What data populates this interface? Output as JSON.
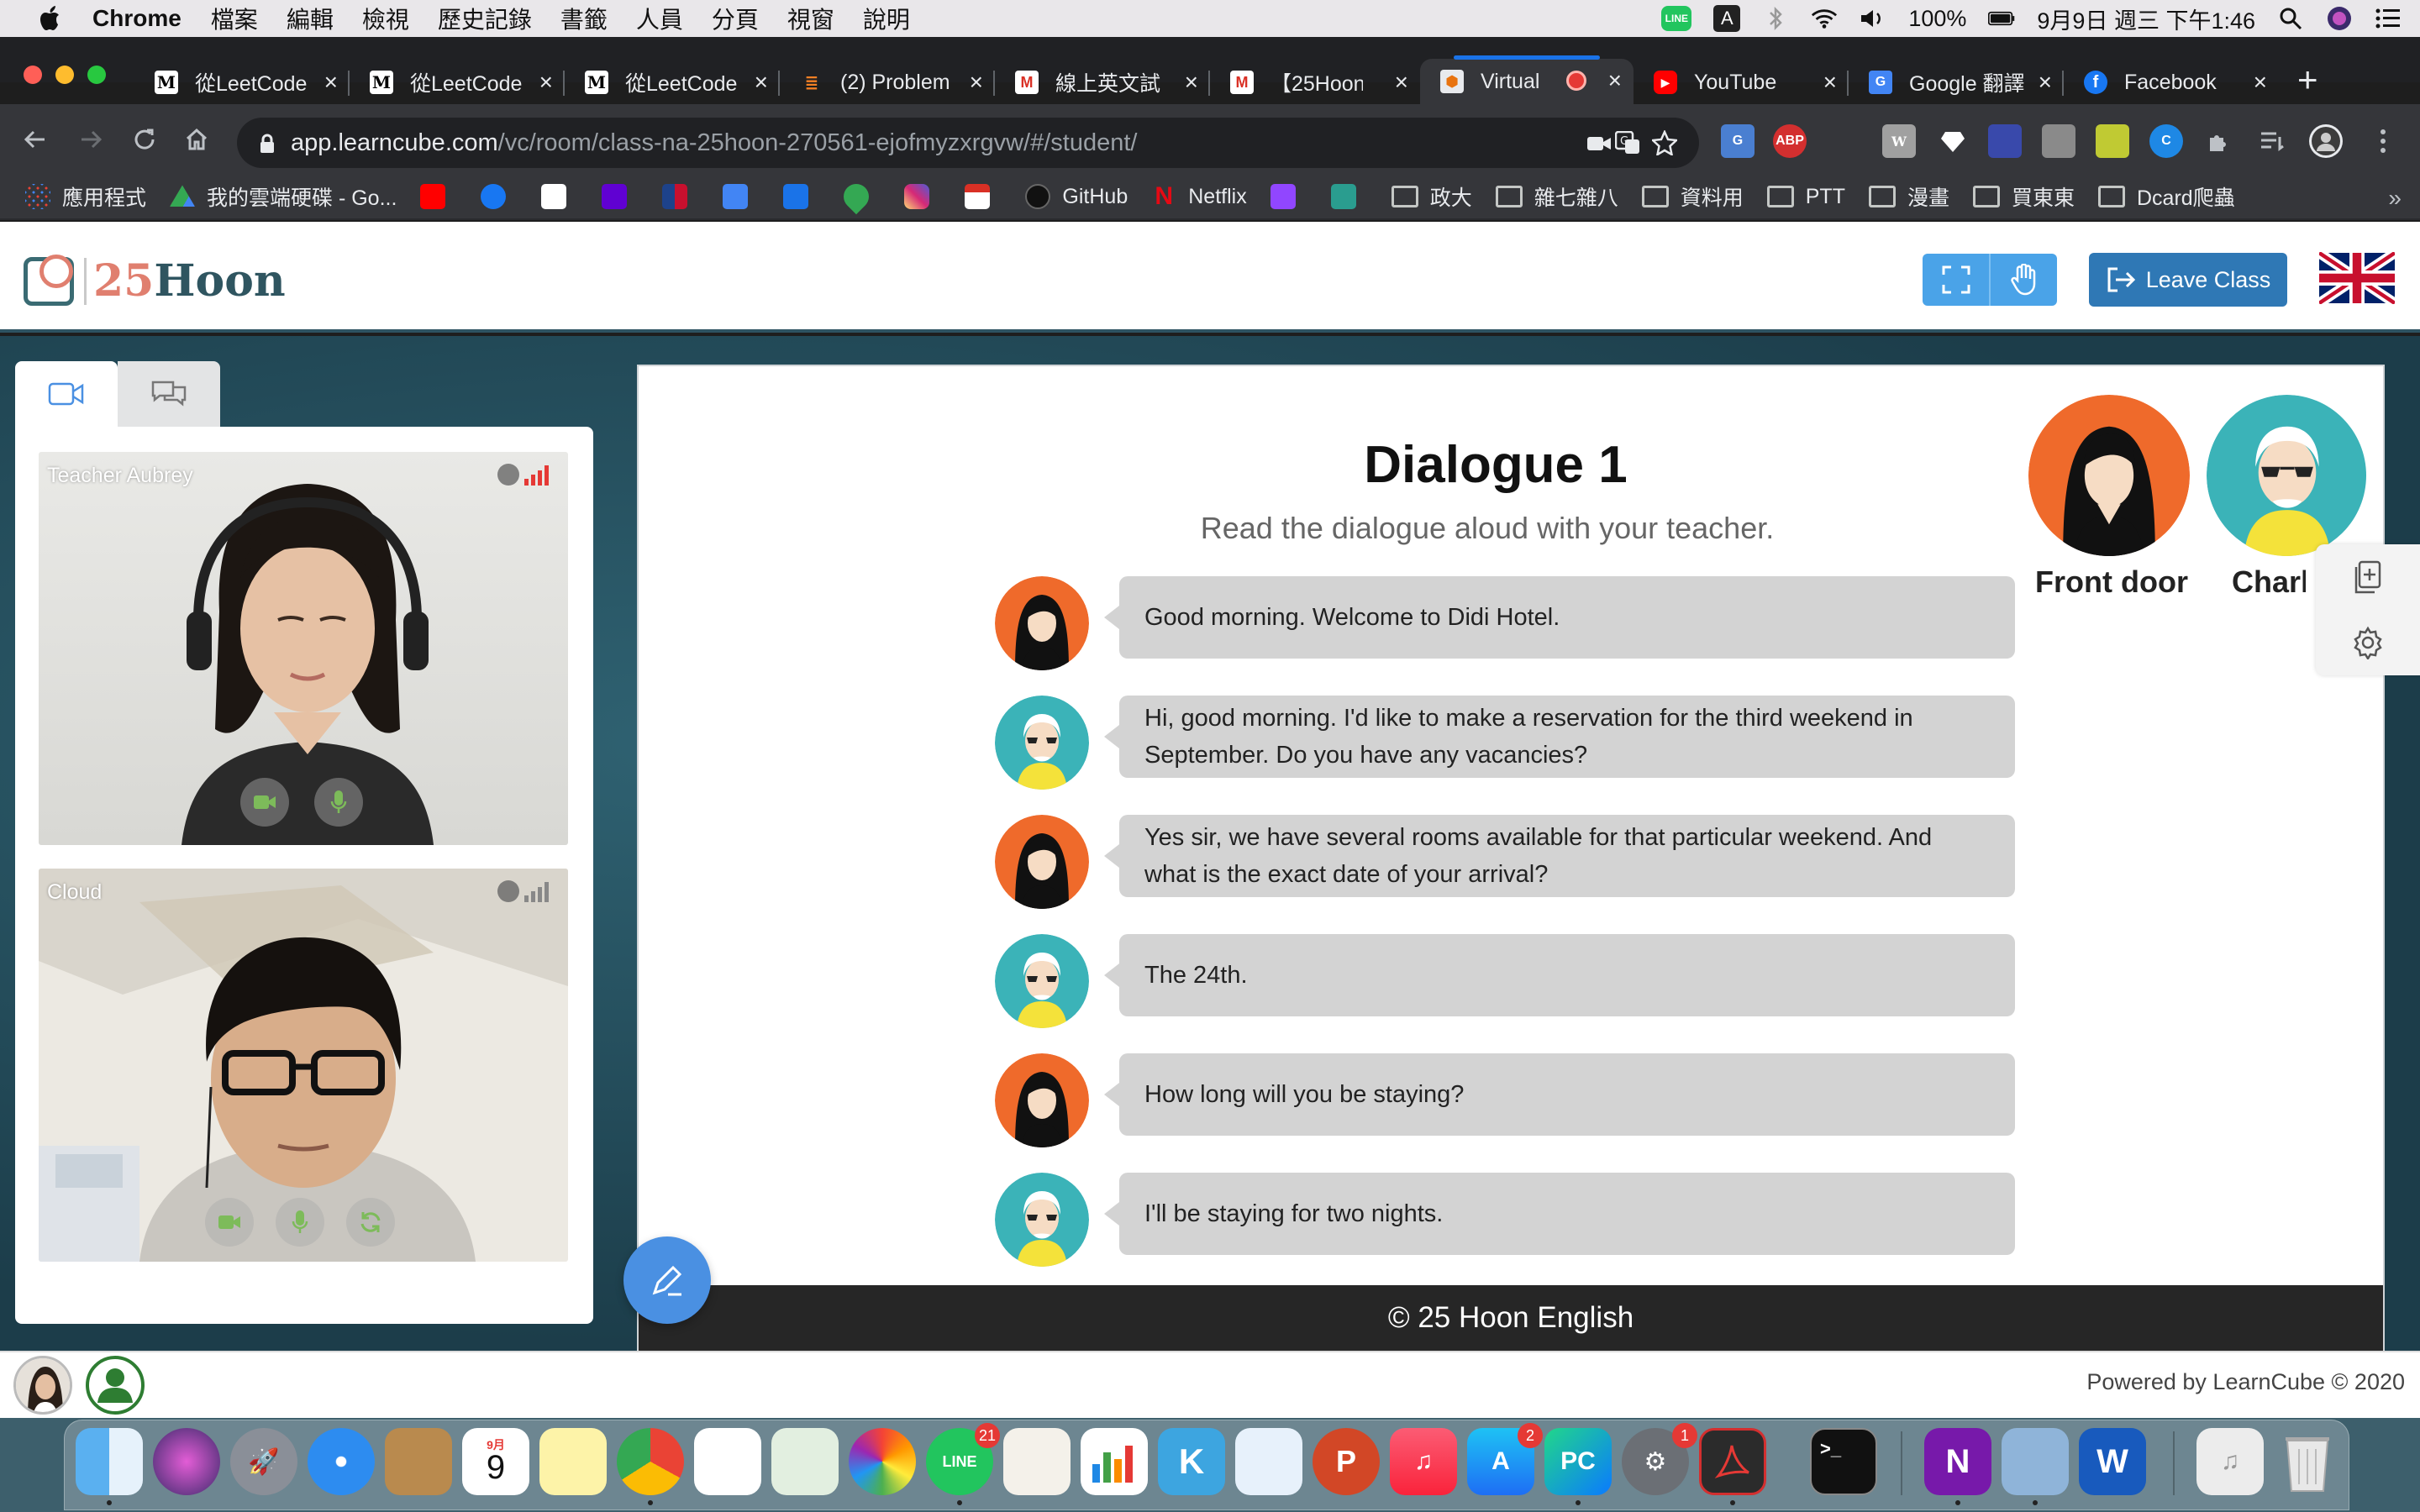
{
  "menubar": {
    "app_name": "Chrome",
    "items": [
      "檔案",
      "編輯",
      "檢視",
      "歷史記錄",
      "書籤",
      "人員",
      "分頁",
      "視窗",
      "說明"
    ],
    "line_label": "LINE",
    "input_label": "A",
    "battery": "100%",
    "datetime": "9月9日 週三 下午1:46"
  },
  "tabs": [
    {
      "title": "從LeetCode",
      "icon": "medium-icon"
    },
    {
      "title": "從LeetCode",
      "icon": "medium-icon"
    },
    {
      "title": "從LeetCode",
      "icon": "medium-icon"
    },
    {
      "title": "(2) Problem",
      "icon": "stackoverflow-icon"
    },
    {
      "title": "線上英文試",
      "icon": "gmail-icon"
    },
    {
      "title": "【25Hoon",
      "icon": "gmail-icon"
    },
    {
      "title": "Virtual",
      "icon": "learncube-icon",
      "active": true
    },
    {
      "title": "YouTube",
      "icon": "youtube-icon"
    },
    {
      "title": "Google 翻譯",
      "icon": "google-translate-icon"
    },
    {
      "title": "Facebook",
      "icon": "facebook-icon"
    }
  ],
  "omnibox": {
    "host": "app.learncube.com",
    "path": "/vc/room/class-na-25hoon-270561-ejofmyzxrgvw/#/student/"
  },
  "extensions": {
    "abp": "ABP",
    "wiki": "W",
    "c": "C"
  },
  "bookmarks": [
    {
      "label": "應用程式",
      "type": "apps"
    },
    {
      "label": "我的雲端硬碟 - Go...",
      "type": "drive"
    },
    {
      "label": "",
      "type": "youtube"
    },
    {
      "label": "",
      "type": "facebook"
    },
    {
      "label": "",
      "type": "wikipedia"
    },
    {
      "label": "",
      "type": "yahoo"
    },
    {
      "label": "",
      "type": "nba"
    },
    {
      "label": "",
      "type": "translate"
    },
    {
      "label": "",
      "type": "docs"
    },
    {
      "label": "",
      "type": "maps"
    },
    {
      "label": "",
      "type": "instagram"
    },
    {
      "label": "",
      "type": "gmail"
    },
    {
      "label": "GitHub",
      "type": "github"
    },
    {
      "label": "Netflix",
      "type": "netflix"
    },
    {
      "label": "",
      "type": "twitch"
    },
    {
      "label": "",
      "type": "other"
    },
    {
      "label": "政大",
      "type": "folder"
    },
    {
      "label": "雜七雜八",
      "type": "folder"
    },
    {
      "label": "資料用",
      "type": "folder"
    },
    {
      "label": "PTT",
      "type": "folder"
    },
    {
      "label": "漫畫",
      "type": "folder"
    },
    {
      "label": "買東東",
      "type": "folder"
    },
    {
      "label": "Dcard爬蟲",
      "type": "folder"
    }
  ],
  "header": {
    "logo_num": "25",
    "logo_word": "Hoon",
    "leave_label": "Leave Class"
  },
  "videos": {
    "teacher_name": "Teacher Aubrey",
    "student_name": "Cloud"
  },
  "slide": {
    "title": "Dialogue 1",
    "subtitle": "Read the dialogue aloud with your teacher.",
    "characters": [
      {
        "name": "Front door",
        "color": "#ef6a2b"
      },
      {
        "name": "Charles",
        "color": "#3bb3b8"
      }
    ],
    "dialogue": [
      {
        "speaker": "front",
        "text": "Good morning. Welcome to Didi Hotel."
      },
      {
        "speaker": "guest",
        "text": "Hi, good morning. I'd like to make a reservation for the third weekend in September. Do you have any vacancies?"
      },
      {
        "speaker": "front",
        "text": "Yes sir, we have several rooms available for that particular weekend. And what is the exact date of your arrival?"
      },
      {
        "speaker": "guest",
        "text": "The 24th."
      },
      {
        "speaker": "front",
        "text": "How long will you be staying?"
      },
      {
        "speaker": "guest",
        "text": "I'll be staying for two nights."
      }
    ],
    "footer": "© 25 Hoon English"
  },
  "bottom": {
    "powered": "Powered by LearnCube © 2020"
  },
  "dock": {
    "calendar_month": "9月",
    "calendar_day": "9",
    "line_badge": "21",
    "appstore_badge": "2",
    "prefs_badge": "1"
  },
  "colors": {
    "accent": "#4aa3e8",
    "leave": "#2f78b5",
    "front_avatar": "#ef6a2b",
    "guest_avatar": "#3bb3b8"
  }
}
